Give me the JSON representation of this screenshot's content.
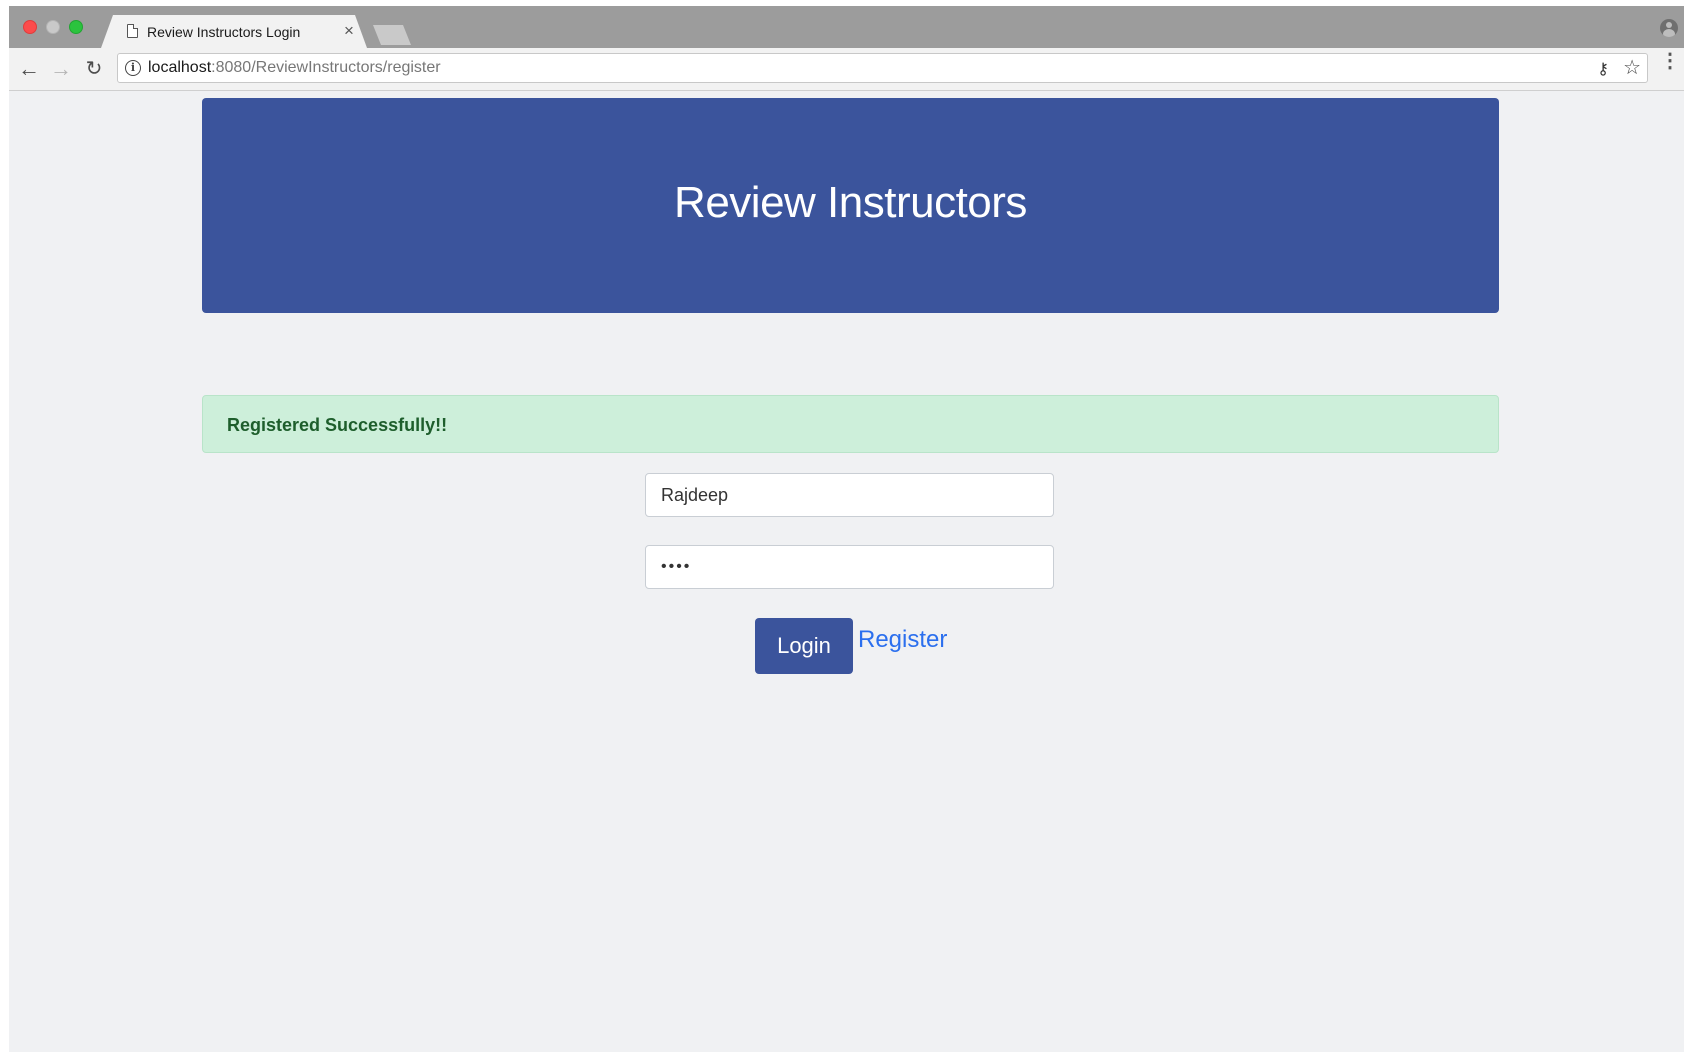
{
  "browser": {
    "tab": {
      "title": "Review Instructors Login",
      "close_glyph": "×"
    },
    "nav": {
      "back_glyph": "←",
      "forward_glyph": "→",
      "reload_glyph": "↻"
    },
    "url": {
      "host": "localhost",
      "path": ":8080/ReviewInstructors/register"
    },
    "icons": {
      "info": "i",
      "key": "⚷",
      "star": "☆",
      "menu": "⋮"
    }
  },
  "page": {
    "header": {
      "title": "Review Instructors",
      "background": "#3b549c"
    },
    "alert": {
      "message": "Registered Successfully!!",
      "background": "#cdefda",
      "text_color": "#1e5e2c"
    },
    "form": {
      "username_value": "Rajdeep",
      "password_masked": "••••",
      "login_label": "Login",
      "register_label": "Register",
      "link_color": "#2b6fee"
    }
  }
}
